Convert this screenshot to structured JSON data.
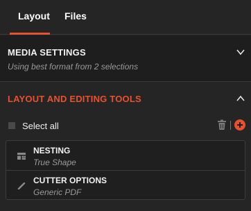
{
  "tabs": [
    {
      "label": "Layout",
      "active": true
    },
    {
      "label": "Files",
      "active": false
    }
  ],
  "media_settings": {
    "title": "MEDIA SETTINGS",
    "subtitle": "Using best format from 2 selections",
    "expanded": false,
    "icon": "chevron-down-icon"
  },
  "layout_tools": {
    "title": "LAYOUT AND EDITING TOOLS",
    "expanded": true,
    "icon": "chevron-up-icon",
    "select_all_label": "Select all",
    "select_all_checked": false,
    "items": [
      {
        "title": "NESTING",
        "subtitle": "True Shape",
        "icon": "nesting-icon"
      },
      {
        "title": "CUTTER OPTIONS",
        "subtitle": "Generic PDF",
        "icon": "pen-icon"
      }
    ]
  },
  "colors": {
    "accent": "#e8512e",
    "background": "#252525",
    "panel": "#1e1e1e",
    "muted_text": "#9a9a9a"
  }
}
